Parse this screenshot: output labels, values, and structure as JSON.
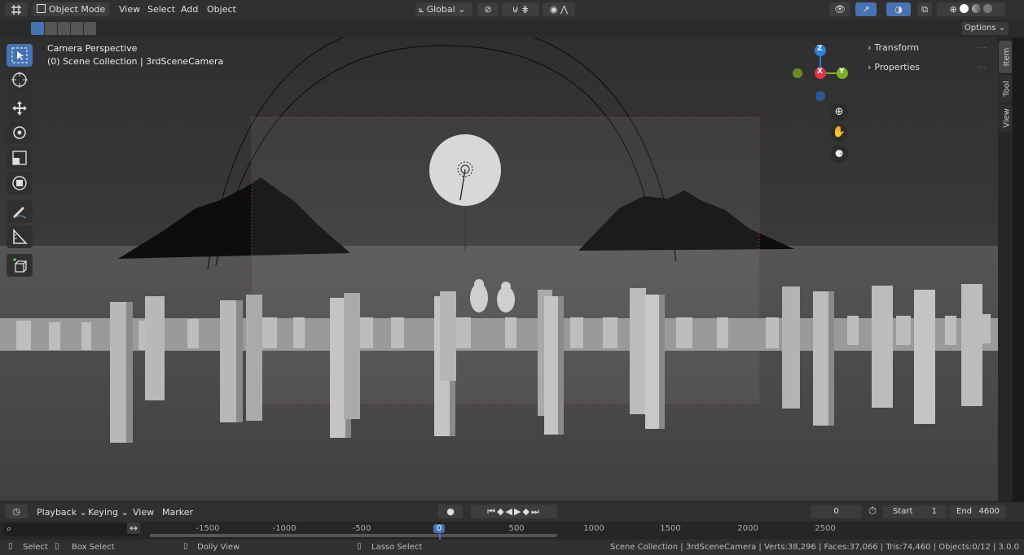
{
  "header": {
    "mode_label": "Object Mode",
    "menu": [
      "View",
      "Select",
      "Add",
      "Object"
    ],
    "transform_orientation": "Global",
    "options_label": "Options"
  },
  "viewport": {
    "perspective_label": "Camera Perspective",
    "collection_label": "(0) Scene Collection | 3rdSceneCamera",
    "gizmo": {
      "z": "Z",
      "x": "X",
      "y": "Y"
    }
  },
  "npanel": {
    "transform_label": "Transform",
    "properties_label": "Properties"
  },
  "side_tabs": [
    "Item",
    "Tool",
    "View"
  ],
  "timeline": {
    "menu": [
      "Playback",
      "Keying",
      "View",
      "Marker"
    ],
    "current_frame": "0",
    "start_label": "Start",
    "start_value": "1",
    "end_label": "End",
    "end_value": "4600",
    "ticks": [
      "-1500",
      "-1000",
      "-500",
      "0",
      "500",
      "1000",
      "1500",
      "2000",
      "2500"
    ]
  },
  "statusbar": {
    "select": "Select",
    "box_select": "Box Select",
    "dolly_view": "Dolly View",
    "lasso_select": "Lasso Select",
    "stats": "Scene Collection | 3rdSceneCamera | Verts:38,296 | Faces:37,066 | Tris:74,460 | Objects:0/12 | 3.0.0"
  },
  "colors": {
    "accent": "#4772b3",
    "axis_x": "#e0344c",
    "axis_y": "#7bb020",
    "axis_z": "#2e7fd6"
  }
}
